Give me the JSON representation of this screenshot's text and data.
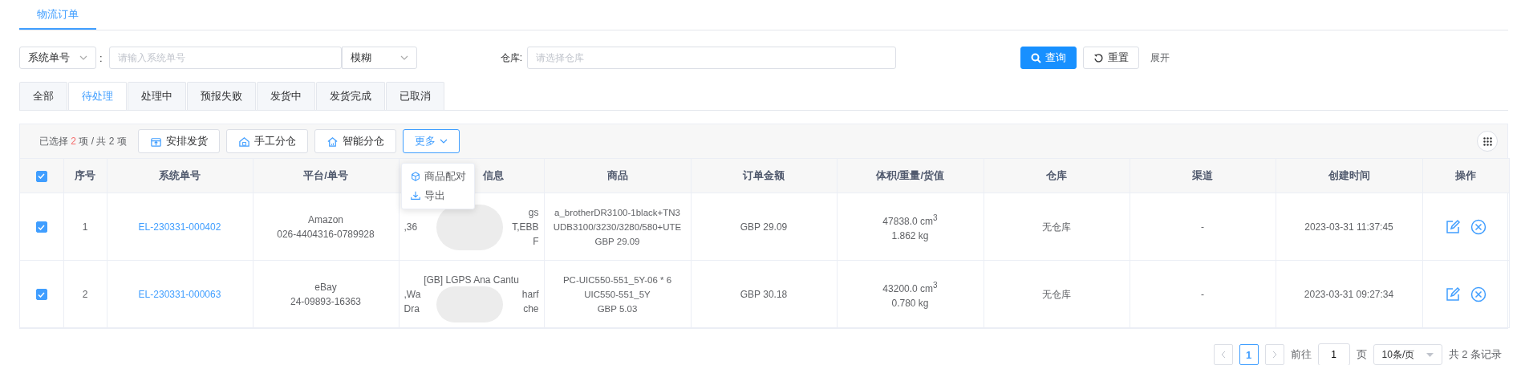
{
  "page_tabs": [
    {
      "label": "物流订单",
      "selected": true
    }
  ],
  "filters": {
    "field_select": "系统单号",
    "separator": ":",
    "order_input": {
      "placeholder": "请输入系统单号"
    },
    "match_select": "模糊",
    "warehouse_label": "仓库:",
    "warehouse_input": {
      "placeholder": "请选择仓库"
    },
    "search_button": "查询",
    "reset_button": "重置",
    "expand_link": "展开"
  },
  "status_tabs": [
    {
      "label": "全部",
      "selected": false
    },
    {
      "label": "待处理",
      "selected": true
    },
    {
      "label": "处理中",
      "selected": false
    },
    {
      "label": "预报失败",
      "selected": false
    },
    {
      "label": "发货中",
      "selected": false
    },
    {
      "label": "发货完成",
      "selected": false
    },
    {
      "label": "已取消",
      "selected": false
    }
  ],
  "toolbar": {
    "selected_prefix": "已选择",
    "selected_count": "2",
    "selected_suffix": "项 / 共 2 项",
    "buttons": [
      "安排发货",
      "手工分仓",
      "智能分仓"
    ],
    "more_button": "更多"
  },
  "more_menu": {
    "items": [
      "商品配对",
      "导出"
    ]
  },
  "table": {
    "header_checked": true,
    "columns": [
      "序号",
      "系统单号",
      "平台/单号",
      "信息",
      "商品",
      "订单金额",
      "体积/重量/货值",
      "仓库",
      "渠道",
      "创建时间",
      "操作"
    ],
    "rows": [
      {
        "checked": true,
        "index": "1",
        "order_no": "EL-230331-000402",
        "platform": [
          "Amazon",
          "026-4404316-0789928"
        ],
        "info_top": [],
        "info_lines": [
          {
            "right": "gs"
          },
          {
            "left": ",36",
            "right": "T,EBB"
          },
          {
            "right": "F"
          }
        ],
        "product": [
          "a_brotherDR3100-1black+TN3",
          "UDB3100/3230/3280/580+UTE",
          "GBP 29.09"
        ],
        "amount": "GBP 29.09",
        "volume": "47838.0 cm$^{3}$",
        "weight": "1.862 kg",
        "warehouse": "无仓库",
        "channel": "-",
        "created": "2023-03-31 11:37:45"
      },
      {
        "checked": true,
        "index": "2",
        "order_no": "EL-230331-000063",
        "platform": [
          "eBay",
          "24-09893-16363"
        ],
        "info_top": [
          "[GB] LGPS Ana Cantu"
        ],
        "info_lines": [
          {
            "left": ",Wa",
            "right": "harf"
          },
          {
            "left": "Dra",
            "right": "che"
          }
        ],
        "product": [
          "PC-UIC550-551_5Y-06 * 6",
          "UIC550-551_5Y",
          "GBP 5.03"
        ],
        "amount": "GBP 30.18",
        "volume": "43200.0 cm$^{3}$",
        "weight": "0.780 kg",
        "warehouse": "无仓库",
        "channel": "-",
        "created": "2023-03-31 09:27:34"
      }
    ]
  },
  "pagination": {
    "pages": [
      {
        "label": "1",
        "selected": true
      }
    ],
    "goto_label": "前往",
    "goto_value": "1",
    "page_unit": "页",
    "page_size": "10条/页",
    "total": "共 2 条记录"
  }
}
